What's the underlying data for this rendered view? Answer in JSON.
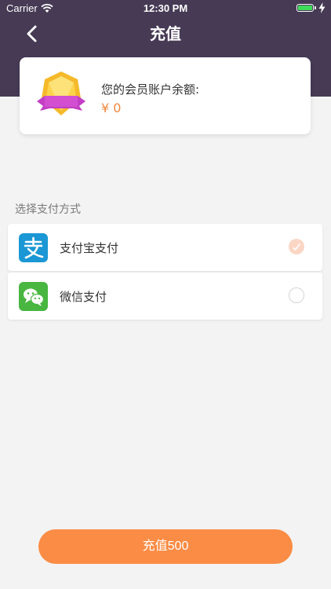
{
  "status_bar": {
    "carrier": "Carrier",
    "time": "12:30 PM",
    "battery_color": "#3fdc5a"
  },
  "header": {
    "title": "充值",
    "back_icon": "chevron-left-icon",
    "background": "#463a55"
  },
  "balance_card": {
    "label": "您的会员账户余额:",
    "amount": "¥ 0",
    "icon": "vip-badge-icon"
  },
  "payment": {
    "section_label": "选择支付方式",
    "options": [
      {
        "label": "支付宝支付",
        "icon": "alipay-icon",
        "selected": true
      },
      {
        "label": "微信支付",
        "icon": "wechat-icon",
        "selected": false
      }
    ]
  },
  "submit": {
    "label": "充值500",
    "color": "#fb8c45"
  }
}
